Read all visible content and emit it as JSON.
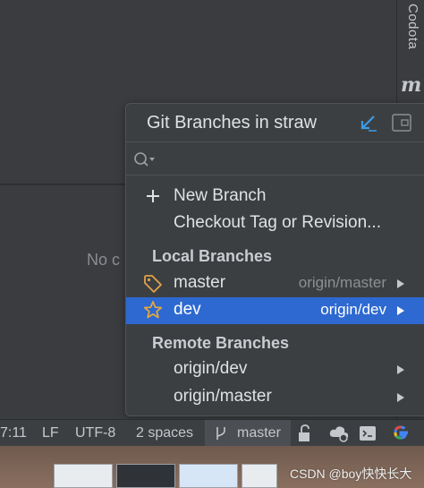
{
  "editor": {
    "empty_text": "No c"
  },
  "tool_strip": {
    "codota_label": "Codota",
    "m_label": "m"
  },
  "popup": {
    "title": "Git Branches in straw",
    "search_placeholder": "",
    "actions": [
      {
        "label": "New Branch",
        "icon": "plus-icon"
      },
      {
        "label": "Checkout Tag or Revision...",
        "icon": ""
      }
    ],
    "local_header": "Local Branches",
    "local_branches": [
      {
        "label": "master",
        "remote": "origin/master",
        "icon": "tag-icon",
        "selected": false
      },
      {
        "label": "dev",
        "remote": "origin/dev",
        "icon": "star-icon",
        "selected": true
      }
    ],
    "remote_header": "Remote Branches",
    "remote_branches": [
      {
        "label": "origin/dev"
      },
      {
        "label": "origin/master"
      }
    ]
  },
  "status_bar": {
    "position": "7:11",
    "line_separator": "LF",
    "encoding": "UTF-8",
    "indent": "2 spaces",
    "branch": "master"
  },
  "watermark": "CSDN @boy快快长大",
  "colors": {
    "selection": "#2e69d1",
    "tag_icon": "#e0a24a",
    "star_icon": "#e8a93a",
    "arrow_icon": "#3c9be6"
  }
}
